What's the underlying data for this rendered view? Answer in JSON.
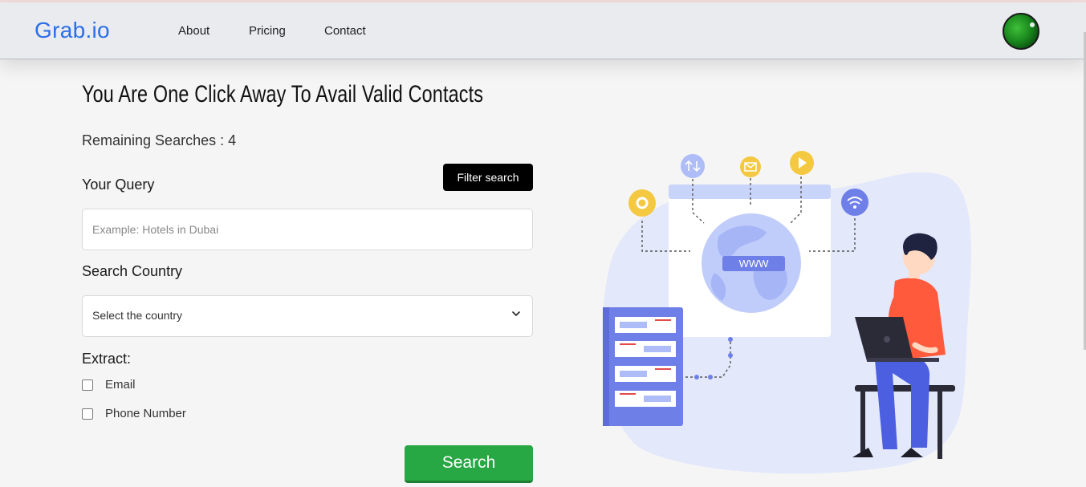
{
  "navbar": {
    "logo": "Grab.io",
    "links": [
      "About",
      "Pricing",
      "Contact"
    ]
  },
  "main": {
    "title": "You Are One Click Away To Avail Valid Contacts",
    "remaining_searches": "Remaining Searches : 4",
    "query_label": "Your Query",
    "filter_button": "Filter search",
    "query_placeholder": "Example: Hotels in Dubai",
    "country_label": "Search Country",
    "country_selected": "Select the country",
    "extract_label": "Extract:",
    "extract_options": [
      "Email",
      "Phone Number"
    ],
    "search_button": "Search"
  },
  "illustration": {
    "globe_label": "WWW"
  },
  "colors": {
    "logo": "#2a6ee8",
    "search_button": "#28a745",
    "filter_button": "#000000",
    "navbar_bg": "#e9ebee",
    "page_bg": "#f5f5f5"
  }
}
